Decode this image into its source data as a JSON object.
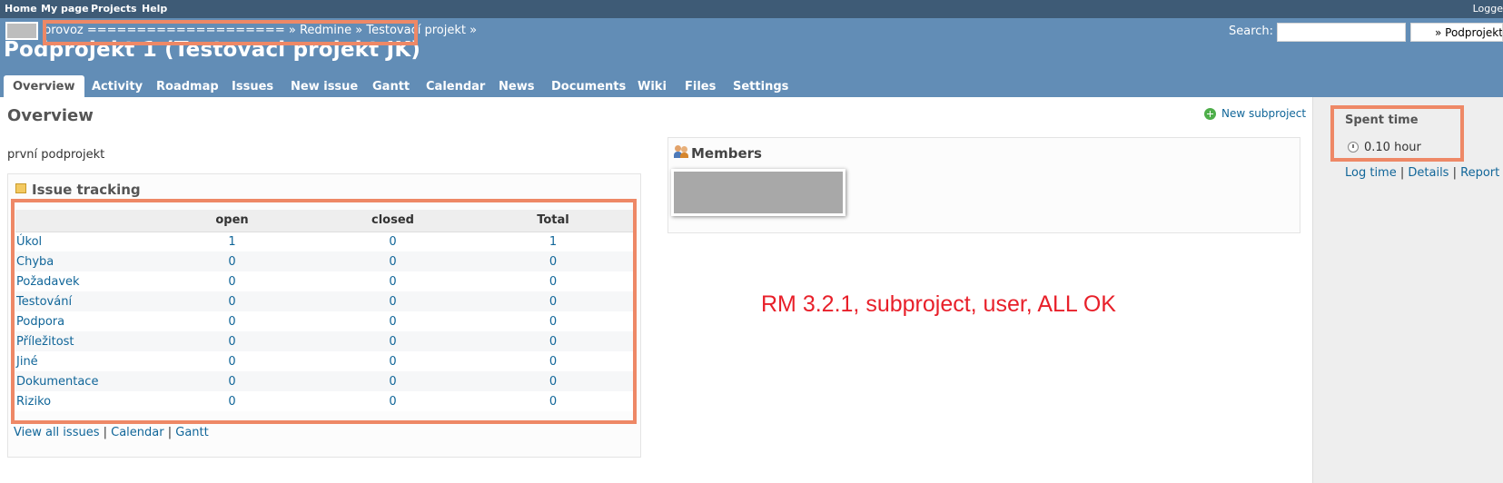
{
  "top_menu": {
    "items": [
      "Home",
      "My page",
      "Projects",
      "Help"
    ],
    "right_label": "Logge"
  },
  "header": {
    "breadcrumb": "provoz ==================== » Redmine » Testovací projekt »",
    "project_title": "Podprojekt 1 (Testovaci projekt JK)",
    "search_label": "Search:",
    "search_value": "",
    "project_jump": "» Podprojekt"
  },
  "main_menu": {
    "tabs": [
      "Overview",
      "Activity",
      "Roadmap",
      "Issues",
      "New issue",
      "Gantt",
      "Calendar",
      "News",
      "Documents",
      "Wiki",
      "Files",
      "Settings"
    ],
    "selected": "Overview"
  },
  "content": {
    "title": "Overview",
    "new_subproject": "New subproject",
    "description": "první podprojekt"
  },
  "issue_tracking": {
    "title": "Issue tracking",
    "columns": [
      "",
      "open",
      "closed",
      "Total"
    ],
    "rows": [
      {
        "name": "Úkol",
        "open": "1",
        "closed": "0",
        "total": "1"
      },
      {
        "name": "Chyba",
        "open": "0",
        "closed": "0",
        "total": "0"
      },
      {
        "name": "Požadavek",
        "open": "0",
        "closed": "0",
        "total": "0"
      },
      {
        "name": "Testování",
        "open": "0",
        "closed": "0",
        "total": "0"
      },
      {
        "name": "Podpora",
        "open": "0",
        "closed": "0",
        "total": "0"
      },
      {
        "name": "Příležitost",
        "open": "0",
        "closed": "0",
        "total": "0"
      },
      {
        "name": "Jiné",
        "open": "0",
        "closed": "0",
        "total": "0"
      },
      {
        "name": "Dokumentace",
        "open": "0",
        "closed": "0",
        "total": "0"
      },
      {
        "name": "Riziko",
        "open": "0",
        "closed": "0",
        "total": "0"
      }
    ],
    "links": [
      "View all issues",
      "Calendar",
      "Gantt"
    ]
  },
  "members": {
    "title": "Members"
  },
  "sidebar": {
    "spent_time_title": "Spent time",
    "spent_time_value": "0.10 hour",
    "links": [
      "Log time",
      "Details",
      "Report"
    ]
  },
  "annotation": "RM 3.2.1, subproject, user, ALL OK",
  "colors": {
    "top_menu_bg": "#3E5B76",
    "header_bg": "#628DB6",
    "highlight": "#EE8866",
    "annotation": "#E8202A",
    "link": "#116699"
  }
}
